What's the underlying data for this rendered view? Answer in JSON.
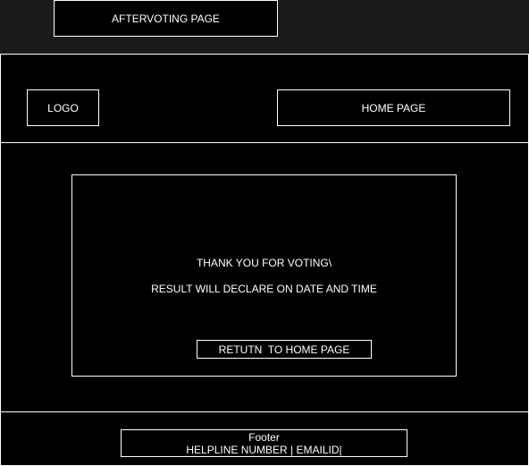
{
  "page_title": "AFTERVOTING PAGE",
  "header": {
    "logo_label": "LOGO",
    "home_page_label": "HOME PAGE"
  },
  "content": {
    "thanks_message": "THANK YOU FOR VOTING\\",
    "result_message": "RESULT WILL DECLARE ON DATE AND TIME",
    "return_button_label": "RETUTN  TO HOME PAGE"
  },
  "footer": {
    "title": "Footer",
    "contact_line": "HELPLINE NUMBER | EMAILID|"
  }
}
